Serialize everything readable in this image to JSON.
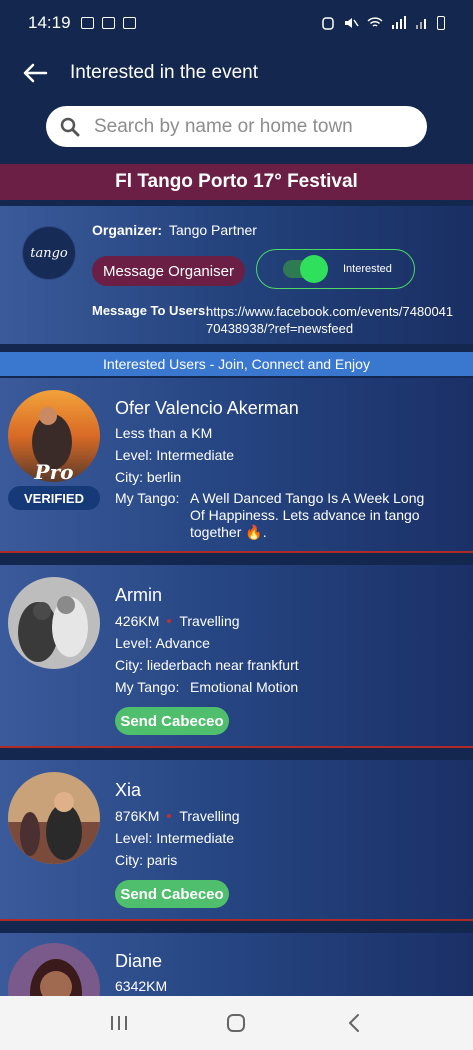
{
  "status_bar": {
    "time": "14:19"
  },
  "header": {
    "title": "Interested in the event",
    "back_icon": "arrow-left-icon"
  },
  "search": {
    "placeholder": "Search by name or home town",
    "value": "",
    "icon": "search-icon"
  },
  "event": {
    "title": "Fl Tango Porto 17° Festival"
  },
  "organizer": {
    "label": "Organizer:",
    "name": "Tango Partner",
    "logo_text": "tango",
    "message_button": "Message Organiser",
    "interest_label": "Interested",
    "interest_on": true,
    "message_users_label": "Message To Users:",
    "message_users_text": "https://www.facebook.com/events/748004170438938/?ref=newsfeed"
  },
  "users_banner": "Interested Users - Join, Connect and Enjoy",
  "users": [
    {
      "name": "Ofer Valencio Akerman",
      "distance": "Less than a KM",
      "travelling": "",
      "level": "Level: Intermediate",
      "city": "City: berlin",
      "tango_label": "My Tango:",
      "tango": "A Well Danced Tango Is A Week Long Of Happiness. Lets advance in tango together 🔥.",
      "pro": true,
      "pro_label": "Pro",
      "verified_label": "VERIFIED",
      "cabeceo": ""
    },
    {
      "name": "Armin",
      "distance": "426KM",
      "travelling": "Travelling",
      "level": "Level: Advance",
      "city": "City: liederbach near frankfurt",
      "tango_label": "My Tango:",
      "tango": "Emotional Motion",
      "cabeceo": "Send Cabeceo"
    },
    {
      "name": "Xia",
      "distance": "876KM",
      "travelling": "Travelling",
      "level": "Level: Intermediate",
      "city": "City: paris",
      "cabeceo": "Send Cabeceo"
    },
    {
      "name": "Diane",
      "distance": "6342KM"
    }
  ],
  "colors": {
    "background": "#13274f",
    "event_bar": "#6c1f45",
    "banner": "#3a78d0",
    "accent_green": "#4fbf6e",
    "divider_red": "#b12a2a"
  }
}
